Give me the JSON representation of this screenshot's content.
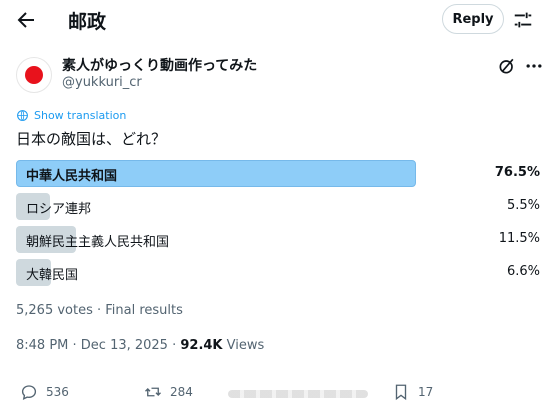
{
  "header": {
    "title": "邮政",
    "reply_label": "Reply"
  },
  "post": {
    "author_name": "素人がゆっくり動画作ってみた",
    "author_handle": "@yukkuri_cr",
    "translate_label": "Show translation",
    "question": "日本の敵国は、どれ？"
  },
  "poll": {
    "options": [
      {
        "label": "中華人民共和国",
        "percent_text": "76.5%",
        "percent": 76.5,
        "winner": true
      },
      {
        "label": "ロシア連邦",
        "percent_text": "5.5%",
        "percent": 5.5,
        "winner": false
      },
      {
        "label": "朝鮮民主主義人民共和国",
        "percent_text": "11.5%",
        "percent": 11.5,
        "winner": false
      },
      {
        "label": "大韓民国",
        "percent_text": "6.6%",
        "percent": 6.6,
        "winner": false
      }
    ],
    "votes_text": "5,265 votes · Final results"
  },
  "meta": {
    "time": "8:48 PM · Dec 13, 2025 · ",
    "views_count": "92.4K",
    "views_label": " Views"
  },
  "actions": {
    "replies": "536",
    "reposts": "284",
    "bookmarks": "17"
  },
  "colors": {
    "accent": "#1d9bf0",
    "winner_bar": "#8ecdf8",
    "bar": "#cfd9de",
    "muted": "#536471"
  },
  "icons": [
    "back-arrow-icon",
    "settings-sliders-icon",
    "grok-icon",
    "more-icon",
    "translate-icon",
    "reply-icon",
    "repost-icon",
    "bookmark-icon"
  ]
}
